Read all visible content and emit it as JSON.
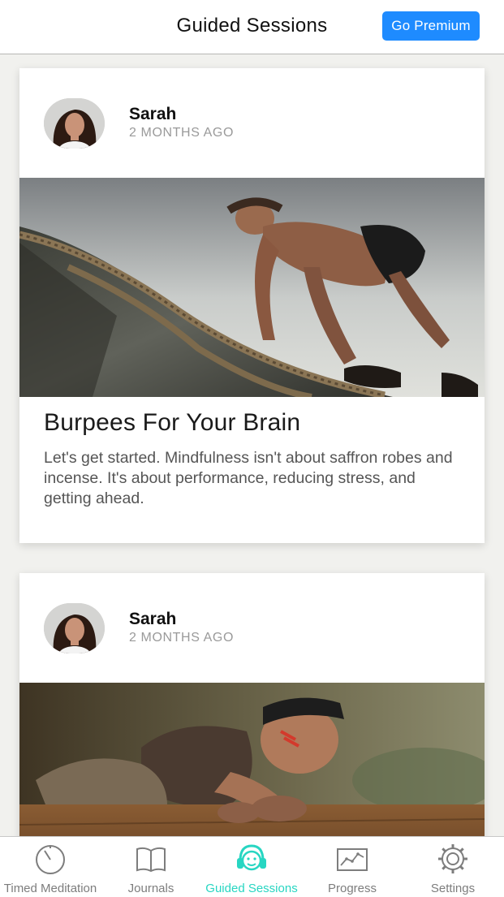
{
  "header": {
    "title": "Guided Sessions",
    "premium_label": "Go Premium",
    "accent_color": "#1e8bff"
  },
  "feed": {
    "posts": [
      {
        "author": "Sarah",
        "time": "2 MONTHS AGO",
        "image": "man-climbing-rope-obstacle-photo",
        "title": "Burpees For Your Brain",
        "description": "Let's get started.  Mindfulness isn't about saffron robes and incense.  It's about performance, reducing stress, and getting ahead."
      },
      {
        "author": "Sarah",
        "time": "2 MONTHS AGO",
        "image": "woman-climbing-wall-obstacle-photo"
      }
    ]
  },
  "tabbar": {
    "active_color": "#27d6c2",
    "items": [
      {
        "label": "Timed Meditation",
        "icon": "timer-icon"
      },
      {
        "label": "Journals",
        "icon": "book-icon"
      },
      {
        "label": "Guided Sessions",
        "icon": "headphones-face-icon",
        "active": true
      },
      {
        "label": "Progress",
        "icon": "chart-icon"
      },
      {
        "label": "Settings",
        "icon": "gear-icon"
      }
    ]
  }
}
